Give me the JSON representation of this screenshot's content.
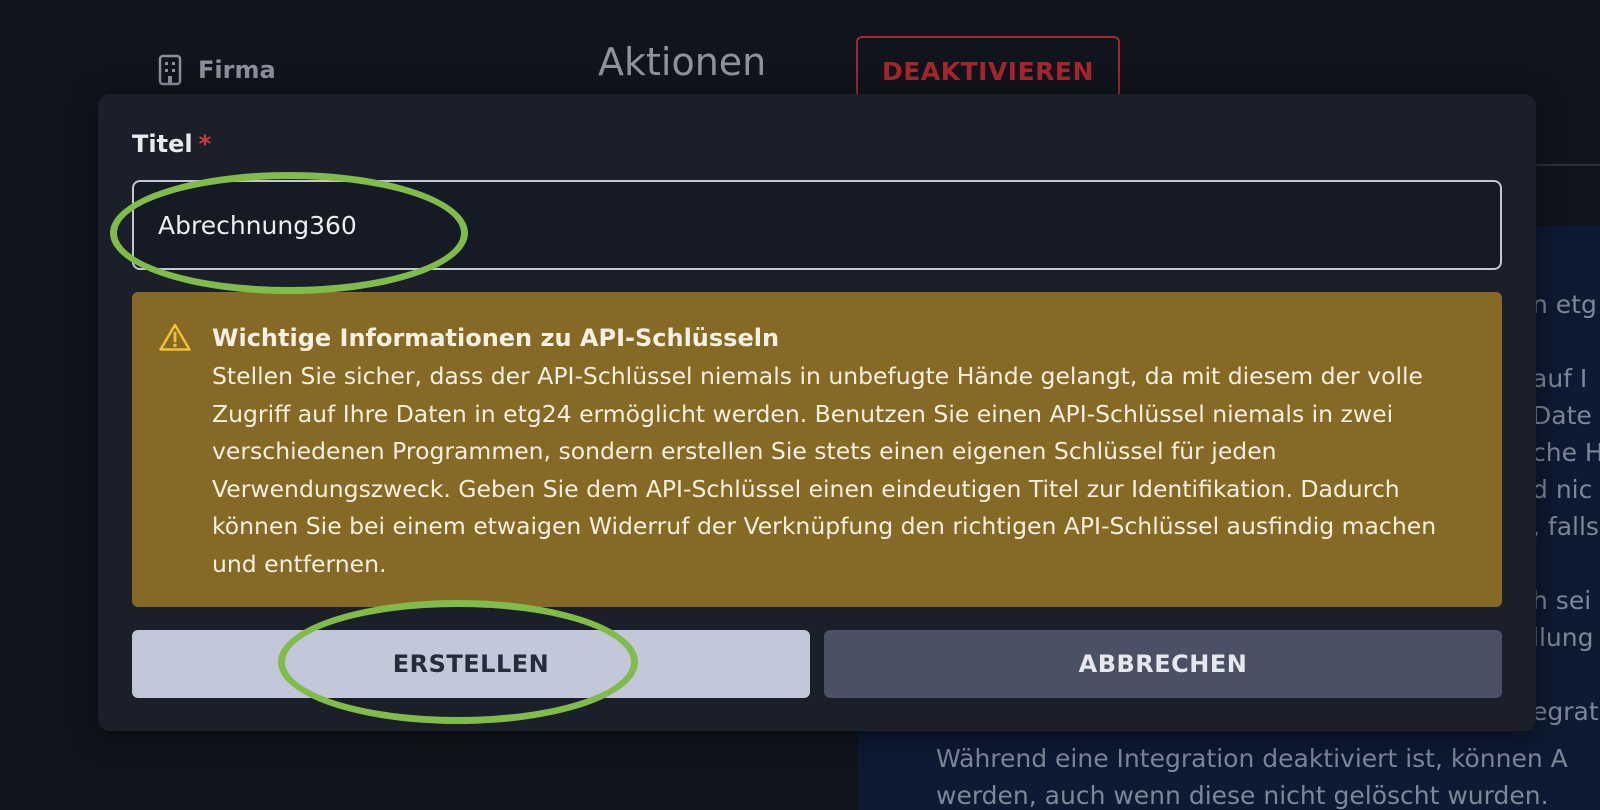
{
  "background": {
    "company_label": "Firma",
    "actions_title": "Aktionen",
    "deactivate_label": "DEAKTIVIEREN",
    "info_fragments_right": [
      "n etg",
      "auf I",
      "Date",
      "che H",
      "d nic",
      ", falls",
      "",
      "h sei",
      "llung",
      "",
      "egrat"
    ],
    "info_text_bottom_1": "Während eine Integration deaktiviert ist, können A",
    "info_text_bottom_2": "werden, auch wenn diese nicht gelöscht wurden."
  },
  "modal": {
    "title_label": "Titel",
    "required_marker": "*",
    "title_value": "Abrechnung360",
    "warning": {
      "title": "Wichtige Informationen zu API-Schlüsseln",
      "text": "Stellen Sie sicher, dass der API-Schlüssel niemals in unbefugte Hände gelangt, da mit diesem der volle Zugriff auf Ihre Daten in etg24 ermöglicht werden. Benutzen Sie einen API-Schlüssel niemals in zwei verschiedenen Programmen, sondern erstellen Sie stets einen eigenen Schlüssel für jeden Verwendungszweck. Geben Sie dem API-Schlüssel einen eindeutigen Titel zur Identifikation. Dadurch können Sie bei einem etwaigen Widerruf der Verknüpfung den richtigen API-Schlüssel ausfindig machen und entfernen."
    },
    "create_label": "ERSTELLEN",
    "cancel_label": "ABBRECHEN"
  },
  "colors": {
    "modal_bg": "#1b1f2a",
    "warning_bg": "#856924",
    "warning_icon": "#f2c233",
    "create_bg": "#c2c8da",
    "cancel_bg": "#4a5165",
    "danger": "#a8262b",
    "annotation": "#7fbc4a"
  }
}
